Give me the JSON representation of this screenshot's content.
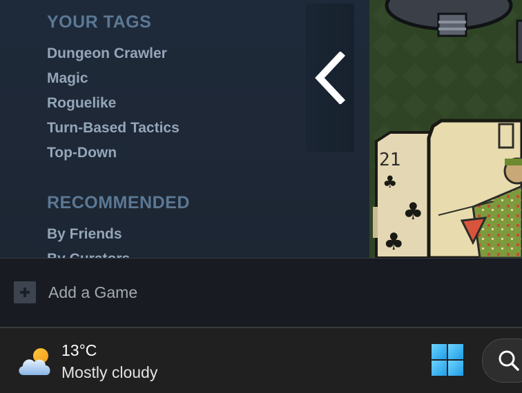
{
  "sidebar": {
    "tags_title": "YOUR TAGS",
    "tags": [
      "Dungeon Crawler",
      "Magic",
      "Roguelike",
      "Turn-Based Tactics",
      "Top-Down"
    ],
    "recommended_title": "RECOMMENDED",
    "recommended": [
      "By Friends",
      "By Curators"
    ]
  },
  "game_art": {
    "card_value": "21"
  },
  "add_game": {
    "icon": "plus-icon",
    "label": "Add a Game"
  },
  "taskbar": {
    "weather": {
      "icon": "partly-cloudy-icon",
      "temperature": "13°C",
      "condition": "Mostly cloudy"
    },
    "start_icon": "windows-logo-icon",
    "search_icon": "search-icon"
  },
  "colors": {
    "sidebar_bg": "#1e2a3a",
    "section_title": "#5b7894",
    "link": "#95a6b9",
    "addbar_bg": "#181b21",
    "taskbar_bg": "#202020",
    "windows_blue": "#4cc2ff"
  }
}
